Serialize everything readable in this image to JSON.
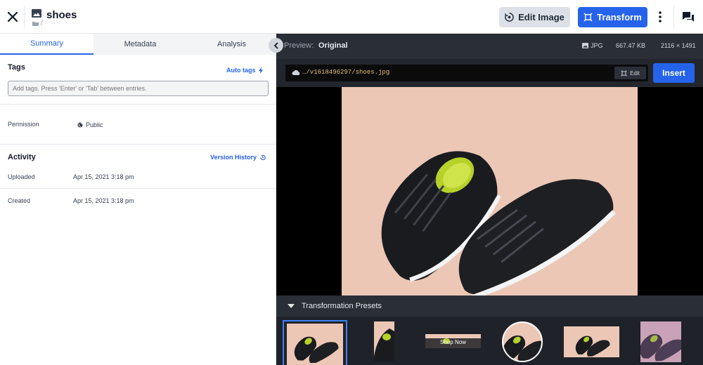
{
  "header": {
    "title": "shoes",
    "breadcrumb": "/",
    "edit_image_label": "Edit Image",
    "transform_label": "Transform",
    "icons": [
      "close-icon",
      "image-icon",
      "folder-icon",
      "edit-image-icon",
      "transform-icon",
      "more-vertical-icon",
      "chat-icon"
    ]
  },
  "tabs": [
    "Summary",
    "Metadata",
    "Analysis"
  ],
  "active_tab": "Summary",
  "tags": {
    "heading": "Tags",
    "auto_tags_label": "Auto tags",
    "placeholder": "Add tags. Press 'Enter' or 'Tab' between entries."
  },
  "permission": {
    "label": "Permission",
    "value": "Public"
  },
  "activity": {
    "heading": "Activity",
    "version_history_label": "Version History",
    "rows": [
      {
        "label": "Uploaded",
        "value": "Apr 15, 2021 3:18 pm"
      },
      {
        "label": "Created",
        "value": "Apr 15, 2021 3:18 pm"
      }
    ]
  },
  "preview": {
    "label": "Preview:",
    "value": "Original",
    "format": "JPG",
    "size": "667.47 KB",
    "dimensions": "2116 × 1491"
  },
  "url": {
    "path": "…/v1618496297/shoes.jpg",
    "edit_label": "Edit"
  },
  "insert_label": "Insert",
  "presets": {
    "title": "Transformation Presets",
    "shop_now_label": "Shop Now"
  },
  "colors": {
    "accent": "#2563eb",
    "dark_panel": "#23262d",
    "photo_bg": "#ecc7b6"
  }
}
